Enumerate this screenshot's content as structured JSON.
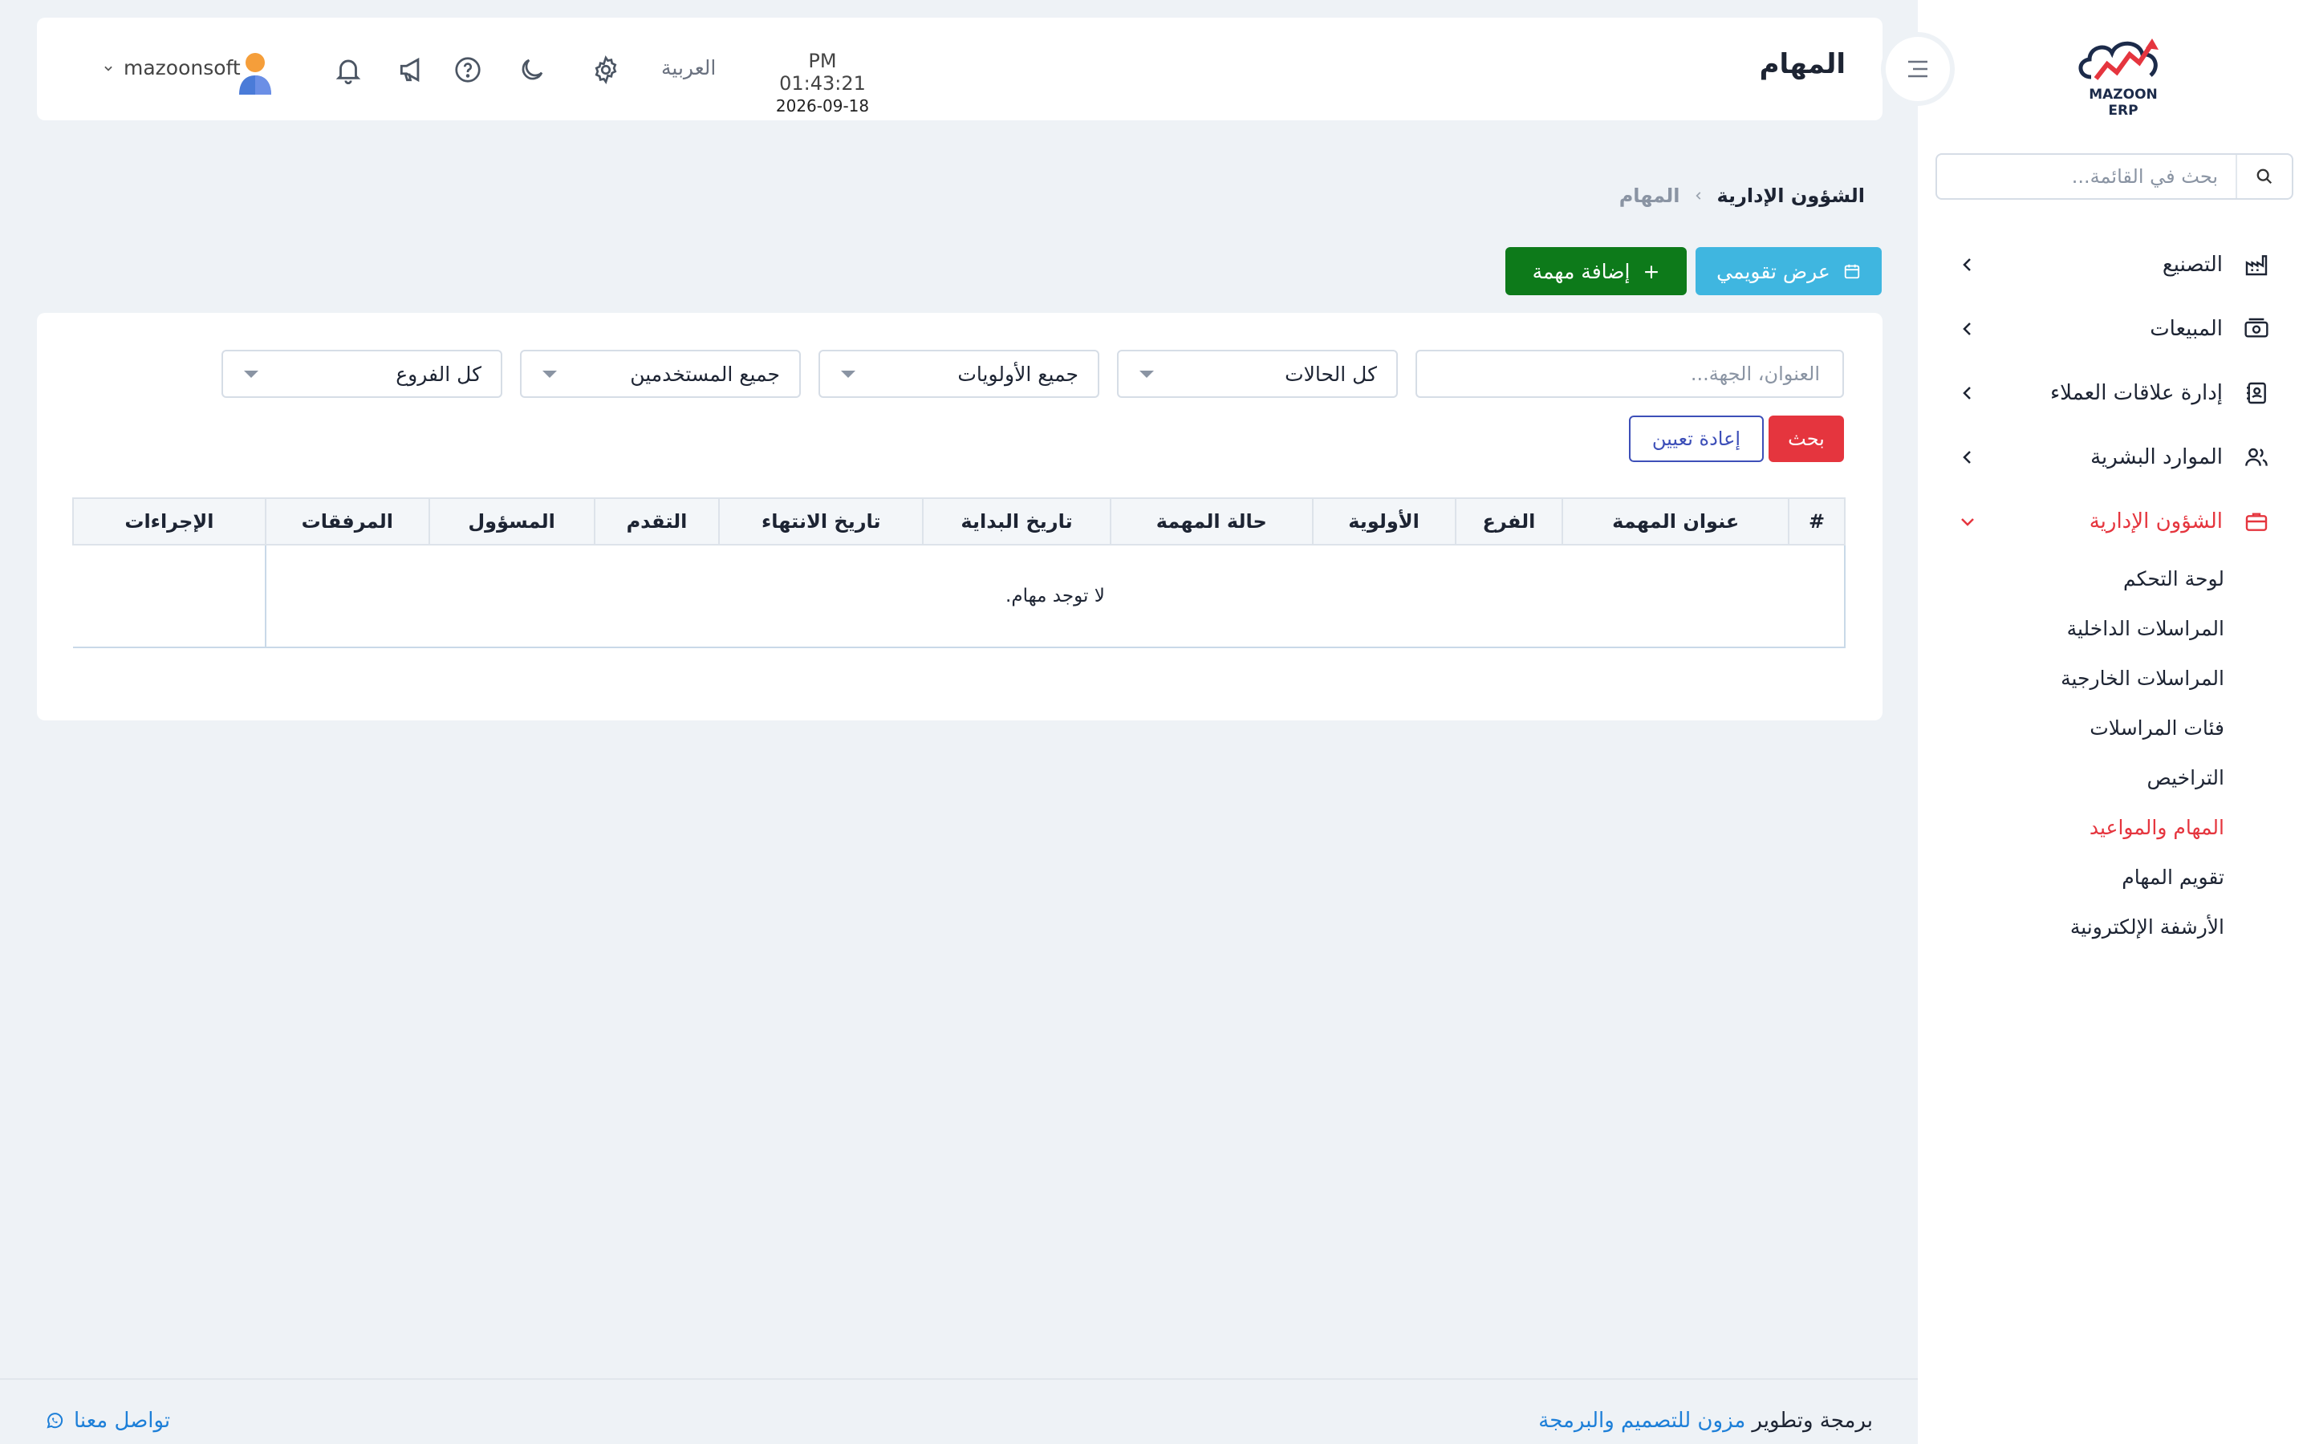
{
  "brand": {
    "logo_text": "MAZOON ERP"
  },
  "sidebar": {
    "search_placeholder": "بحث في القائمة...",
    "items": [
      {
        "label": "التصنيع",
        "icon": "factory-icon"
      },
      {
        "label": "المبيعات",
        "icon": "cash-icon"
      },
      {
        "label": "إدارة علاقات العملاء",
        "icon": "contacts-book-icon"
      },
      {
        "label": "الموارد البشرية",
        "icon": "users-icon"
      },
      {
        "label": "الشؤون الإدارية",
        "icon": "briefcase-icon",
        "expanded": true
      }
    ],
    "submenu": [
      {
        "label": "لوحة التحكم"
      },
      {
        "label": "المراسلات الداخلية"
      },
      {
        "label": "المراسلات الخارجية"
      },
      {
        "label": "فئات المراسلات"
      },
      {
        "label": "التراخيص"
      },
      {
        "label": "المهام والمواعيد",
        "active": true
      },
      {
        "label": "تقويم المهام"
      },
      {
        "label": "الأرشفة الإلكترونية"
      }
    ]
  },
  "header": {
    "title": "المهام",
    "time": "PM 01:43:21",
    "date": "2026-09-18",
    "language": "العربية",
    "username": "mazoonsoft"
  },
  "breadcrumb": {
    "parent": "الشؤون الإدارية",
    "current": "المهام"
  },
  "actions": {
    "calendar_label": "عرض تقويمي",
    "add_label": "إضافة مهمة",
    "add_symbol": "+"
  },
  "filters": {
    "text_placeholder": "العنوان، الجهة...",
    "status": "كل الحالات",
    "priority": "جميع الأولويات",
    "users": "جميع المستخدمين",
    "branches": "كل الفروع",
    "search_label": "بحث",
    "reset_label": "إعادة تعيين"
  },
  "table": {
    "columns": [
      "#",
      "عنوان المهمة",
      "الفرع",
      "الأولوية",
      "حالة المهمة",
      "تاريخ البداية",
      "تاريخ الانتهاء",
      "التقدم",
      "المسؤول",
      "المرفقات",
      "الإجراءات"
    ],
    "empty_message": "لا توجد مهام."
  },
  "footer": {
    "credit_prefix": "برمجة وتطوير",
    "company": "مزون للتصميم والبرمجة",
    "contact": "تواصل معنا"
  },
  "colors": {
    "accent_red": "#e5353e",
    "calendar_button": "#3fb6e0",
    "add_button": "#0d7a1a",
    "reset_border": "#3d4fb8",
    "link": "#1d7fd8"
  }
}
